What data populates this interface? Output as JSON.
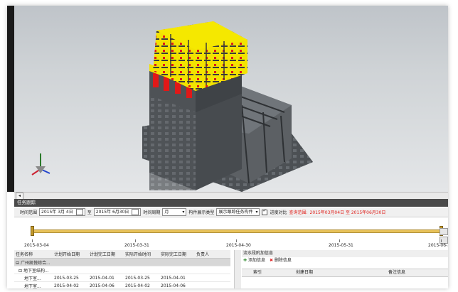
{
  "panel": {
    "title": "任务跟踪"
  },
  "filter": {
    "range_label": "时间范围",
    "start_date": "2015年 3月 4日",
    "to_label": "至",
    "end_date": "2015年 6月30日",
    "period_label": "时间周期",
    "period_value": "月",
    "display_type_label": "构件展示类型",
    "display_type_value": "展示跟踪任务构件",
    "progress_compare_label": "进度对比",
    "query_range_label": "查询范围:",
    "query_range_value": "2015年03月04日 至 2015年06月30日"
  },
  "timeline": {
    "ticks": [
      "2015-03-04",
      "2015-03-31",
      "2015-04-30",
      "2015-05-31",
      "2015-06-30"
    ]
  },
  "tasks": {
    "headers": [
      "任务名称",
      "计划开始日期",
      "计划完工日期",
      "实际开始时间",
      "实际完工日期",
      "负责人"
    ],
    "rows": [
      {
        "name": "广州凯悦综合...",
        "plan_start": "",
        "plan_end": "",
        "act_start": "",
        "act_end": "",
        "owner": ""
      },
      {
        "name": "地下室结构...",
        "plan_start": "",
        "plan_end": "",
        "act_start": "",
        "act_end": "",
        "owner": ""
      },
      {
        "name": "地下室...",
        "plan_start": "2015-03-25",
        "plan_end": "2015-04-01",
        "act_start": "2015-03-25",
        "act_end": "2015-04-01",
        "owner": ""
      },
      {
        "name": "地下室...",
        "plan_start": "2015-04-02",
        "plan_end": "2015-04-06",
        "act_start": "2015-04-02",
        "act_end": "2015-04-06",
        "owner": ""
      }
    ]
  },
  "info": {
    "title": "流水段附加信息",
    "add_label": "添加信息",
    "delete_label": "删除信息",
    "headers": [
      "索引",
      "创建日期",
      "备注信息"
    ]
  },
  "colors": {
    "accent_red": "#e0201b",
    "highlight_yellow": "#f5e500",
    "building_gray": "#555a5e"
  }
}
